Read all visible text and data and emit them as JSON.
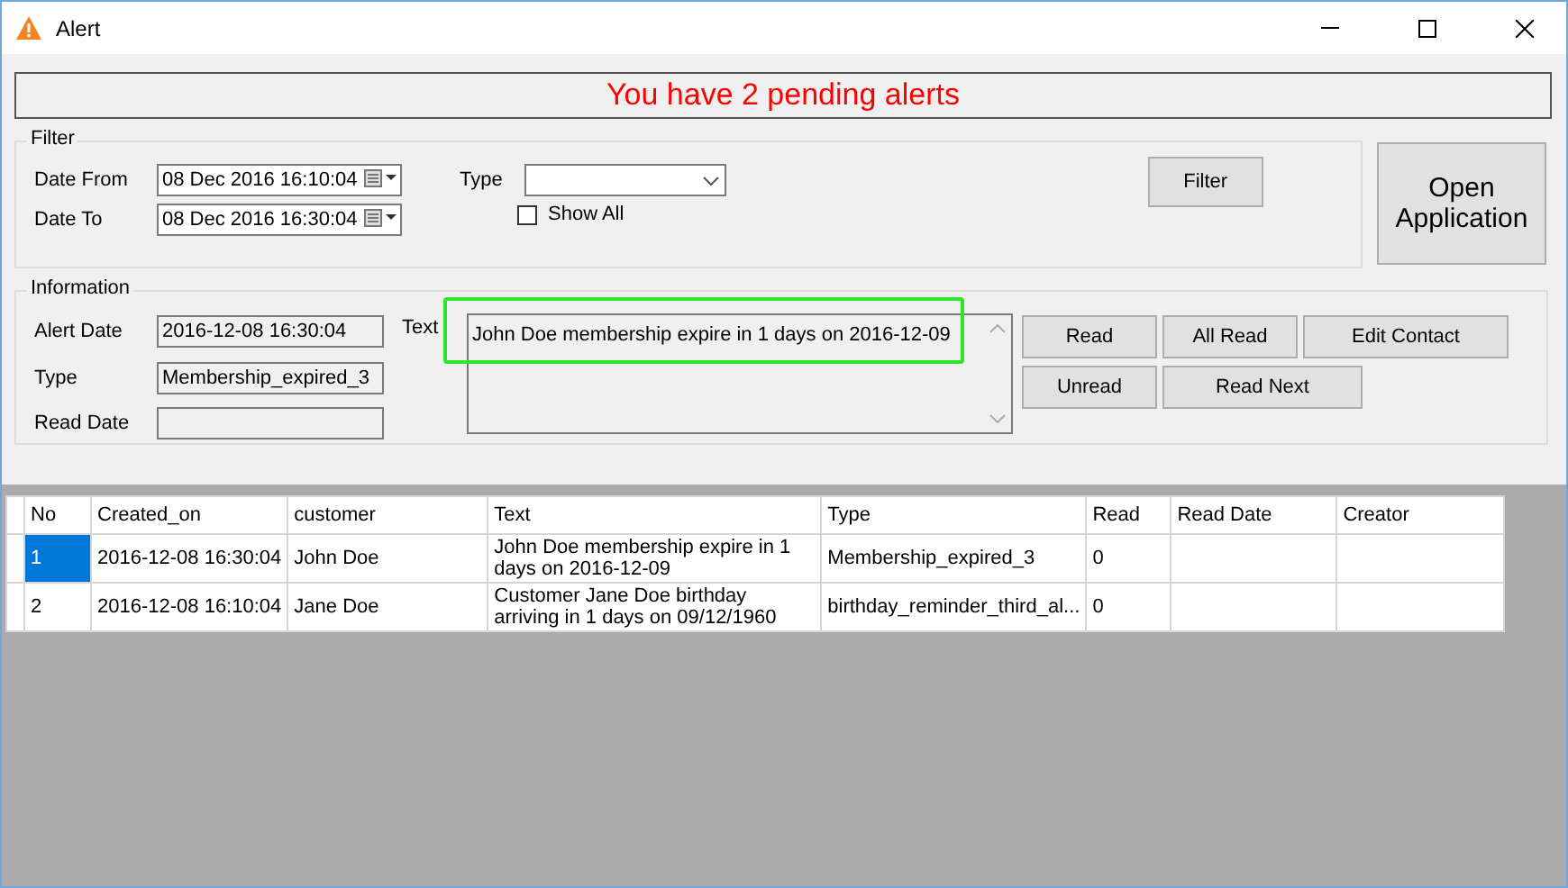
{
  "window": {
    "title": "Alert"
  },
  "banner": "You have 2 pending alerts",
  "filter": {
    "legend": "Filter",
    "date_from": {
      "label": "Date From",
      "value": "08 Dec 2016 16:10:04"
    },
    "date_to": {
      "label": "Date To",
      "value": "08 Dec 2016 16:30:04"
    },
    "type": {
      "label": "Type"
    },
    "show_all": {
      "label": "Show All",
      "checked": false
    },
    "button": "Filter"
  },
  "open_button": "Open Application",
  "information": {
    "legend": "Information",
    "alert_date": {
      "label": "Alert Date",
      "value": "2016-12-08 16:30:04"
    },
    "type": {
      "label": "Type",
      "value": "Membership_expired_3"
    },
    "read_date": {
      "label": "Read Date"
    },
    "text": {
      "label": "Text",
      "value": "John Doe membership expire in 1 days on 2016-12-09"
    },
    "buttons": [
      [
        "Read",
        "All Read",
        "Edit Contact"
      ],
      [
        "Unread",
        "Read Next"
      ]
    ]
  },
  "table": {
    "columns": [
      "No",
      "Created_on",
      "customer",
      "Text",
      "Type",
      "Read",
      "Read Date",
      "Creator"
    ],
    "rows": [
      {
        "selected": true,
        "cells": [
          "1",
          "2016-12-08 16:30:04",
          "John Doe",
          "John Doe membership expire in 1 days on 2016-12-09",
          "Membership_expired_3",
          "0",
          "",
          ""
        ]
      },
      {
        "selected": false,
        "cells": [
          "2",
          "2016-12-08 16:10:04",
          "Jane Doe",
          "Customer Jane Doe birthday arriving in 1 days on 09/12/1960",
          "birthday_reminder_third_al...",
          "0",
          "",
          ""
        ]
      }
    ]
  }
}
